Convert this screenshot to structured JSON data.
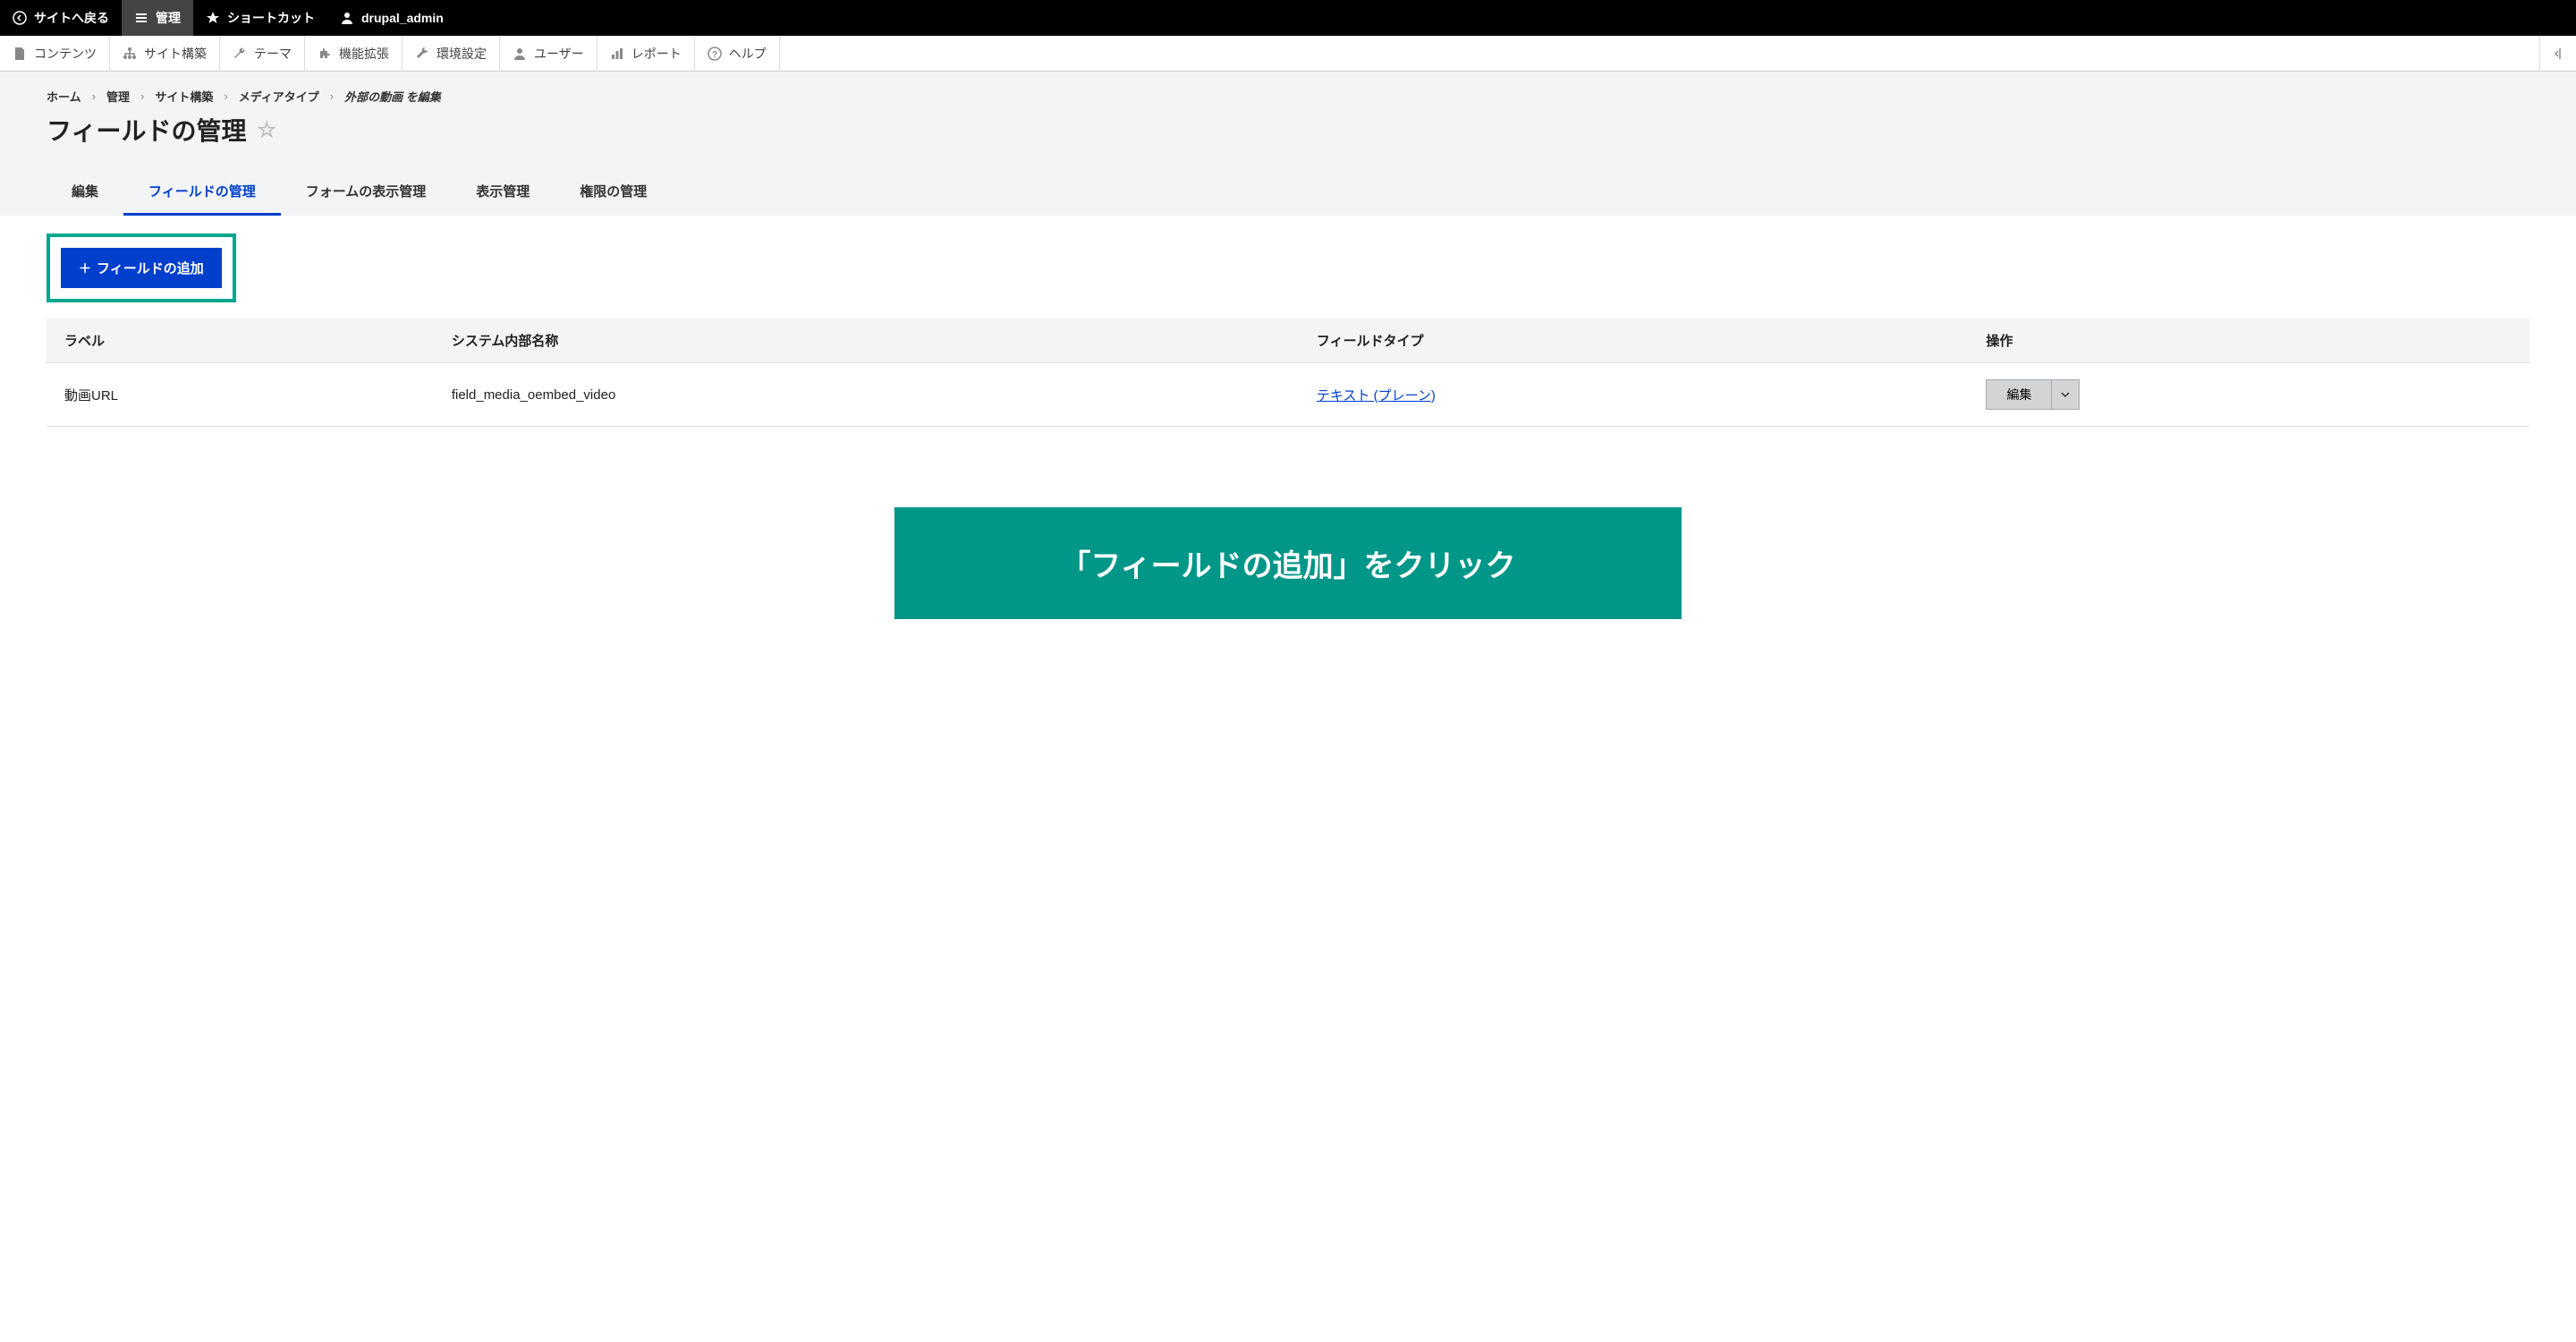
{
  "top_toolbar": {
    "back_to_site": "サイトへ戻る",
    "manage": "管理",
    "shortcuts": "ショートカット",
    "user": "drupal_admin"
  },
  "secondary_toolbar": {
    "content": "コンテンツ",
    "structure": "サイト構築",
    "appearance": "テーマ",
    "extend": "機能拡張",
    "configuration": "環境設定",
    "people": "ユーザー",
    "reports": "レポート",
    "help": "ヘルプ"
  },
  "breadcrumb": {
    "items": [
      "ホーム",
      "管理",
      "サイト構築",
      "メディアタイプ"
    ],
    "current": "外部の動画 を編集",
    "separator": "›"
  },
  "page_title": "フィールドの管理",
  "tabs": {
    "edit": "編集",
    "manage_fields": "フィールドの管理",
    "manage_form": "フォームの表示管理",
    "manage_display": "表示管理",
    "permissions": "権限の管理"
  },
  "actions": {
    "add_field": "フィールドの追加"
  },
  "table": {
    "headers": {
      "label": "ラベル",
      "machine_name": "システム内部名称",
      "field_type": "フィールドタイプ",
      "operations": "操作"
    },
    "rows": [
      {
        "label": "動画URL",
        "machine_name": "field_media_oembed_video",
        "field_type": "テキスト (プレーン)",
        "operation": "編集"
      }
    ]
  },
  "annotation": "「フィールドの追加」をクリック"
}
